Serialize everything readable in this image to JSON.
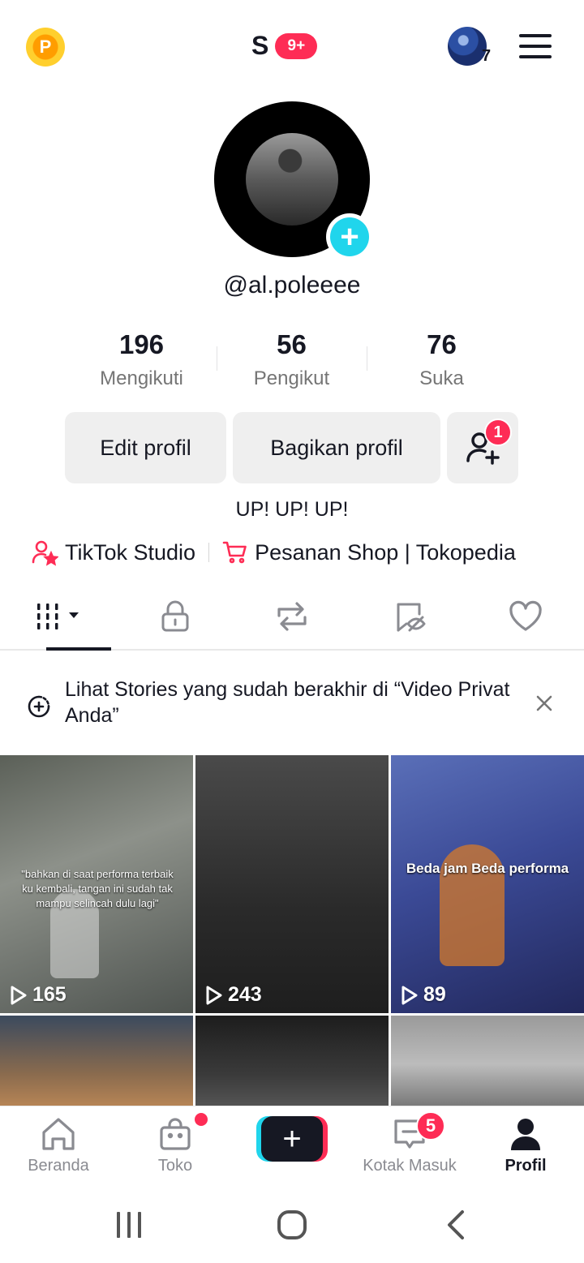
{
  "header": {
    "coin_letter": "P",
    "account_letter": "S",
    "account_badge": "9+",
    "friend_count": "7"
  },
  "profile": {
    "username": "@al.poleeee",
    "stats": [
      {
        "value": "196",
        "label": "Mengikuti"
      },
      {
        "value": "56",
        "label": "Pengikut"
      },
      {
        "value": "76",
        "label": "Suka"
      }
    ],
    "edit_label": "Edit profil",
    "share_label": "Bagikan profil",
    "add_friend_badge": "1",
    "bio": "UP! UP! UP!",
    "links": [
      {
        "label": "TikTok Studio"
      },
      {
        "label": "Pesanan Shop | Tokopedia"
      }
    ]
  },
  "notice": {
    "text": "Lihat Stories yang sudah berakhir di “Video Privat Anda”"
  },
  "grid": {
    "videos": [
      {
        "views": "165",
        "caption": "\"bahkan di saat performa terbaik ku kembali, tangan ini sudah tak mampu selincah dulu lagi\""
      },
      {
        "views": "243"
      },
      {
        "views": "89",
        "caption": "Beda jam Beda performa"
      },
      {},
      {},
      {}
    ]
  },
  "bottom_nav": {
    "home": "Beranda",
    "shop": "Toko",
    "inbox": "Kotak Masuk",
    "inbox_badge": "5",
    "profile": "Profil"
  },
  "colors": {
    "accent": "#fe2c55",
    "cyan": "#20d5ec",
    "text": "#161823",
    "muted": "#757575"
  }
}
